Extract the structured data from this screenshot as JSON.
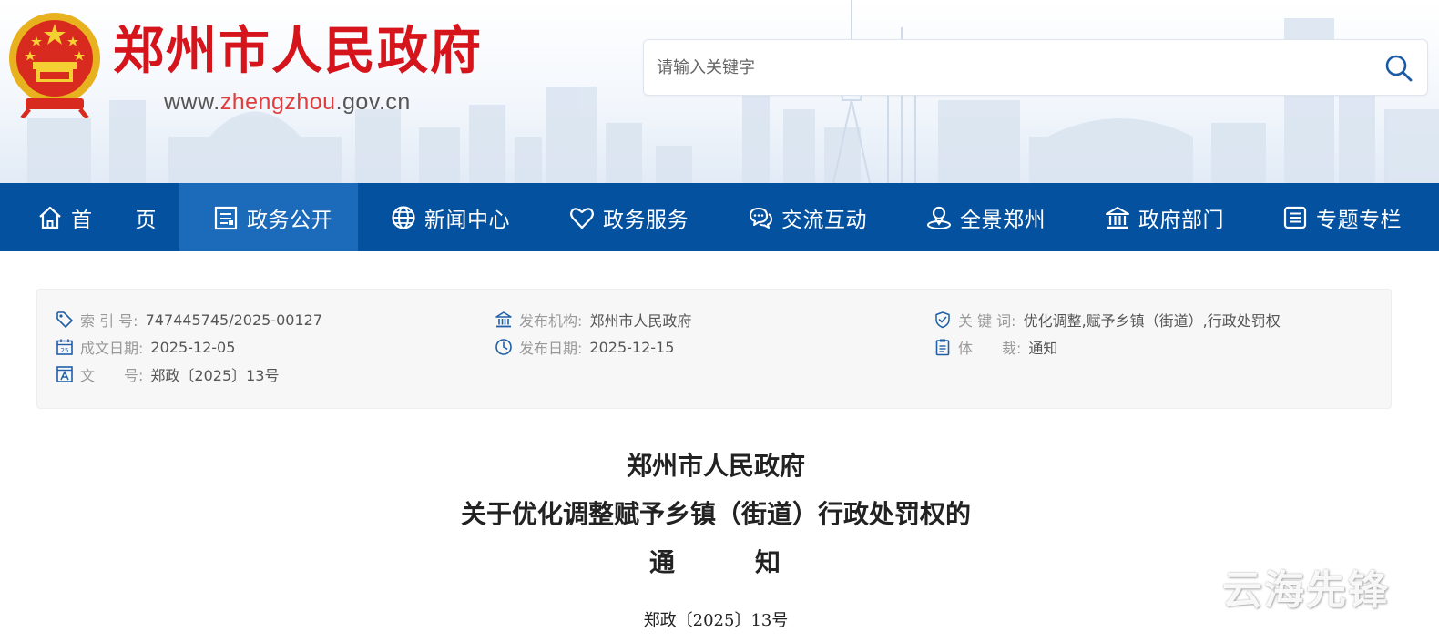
{
  "header": {
    "site_title": "郑州市人民政府",
    "url_prefix": "www.",
    "url_highlight": "zhengzhou",
    "url_suffix": ".gov.cn"
  },
  "search": {
    "placeholder": "请输入关键字"
  },
  "nav": {
    "items": [
      {
        "label": "首　　页",
        "icon": "home-icon"
      },
      {
        "label": "政务公开",
        "icon": "document-list-icon",
        "active": true
      },
      {
        "label": "新闻中心",
        "icon": "globe-icon"
      },
      {
        "label": "政务服务",
        "icon": "heart-icon"
      },
      {
        "label": "交流互动",
        "icon": "chat-icon"
      },
      {
        "label": "全景郑州",
        "icon": "location-icon"
      },
      {
        "label": "政府部门",
        "icon": "building-icon"
      },
      {
        "label": "专题专栏",
        "icon": "list-icon"
      }
    ]
  },
  "meta": {
    "index_no": {
      "label": "索 引 号:",
      "value": "747445745/2025-00127",
      "icon": "tag-icon"
    },
    "date_made": {
      "label": "成文日期:",
      "value": "2025-12-05",
      "icon": "calendar-icon"
    },
    "doc_no": {
      "label": "文　　号:",
      "value": "郑政〔2025〕13号",
      "icon": "doc-number-icon"
    },
    "publisher": {
      "label": "发布机构:",
      "value": "郑州市人民政府",
      "icon": "institution-icon"
    },
    "pub_date": {
      "label": "发布日期:",
      "value": "2025-12-15",
      "icon": "clock-icon"
    },
    "keywords": {
      "label": "关 键 词:",
      "value": "优化调整,赋予乡镇（街道）,行政处罚权",
      "icon": "shield-check-icon"
    },
    "genre": {
      "label": "体　　裁:",
      "value": "通知",
      "icon": "clipboard-icon"
    }
  },
  "document": {
    "title_line1": "郑州市人民政府",
    "title_line2": "关于优化调整赋予乡镇（街道）行政处罚权的",
    "title_line3": "通知",
    "number": "郑政〔2025〕13号"
  },
  "watermark": "云海先锋",
  "colors": {
    "brand_red": "#d5141b",
    "nav_blue": "#04519f",
    "nav_active": "#1b6bba"
  }
}
